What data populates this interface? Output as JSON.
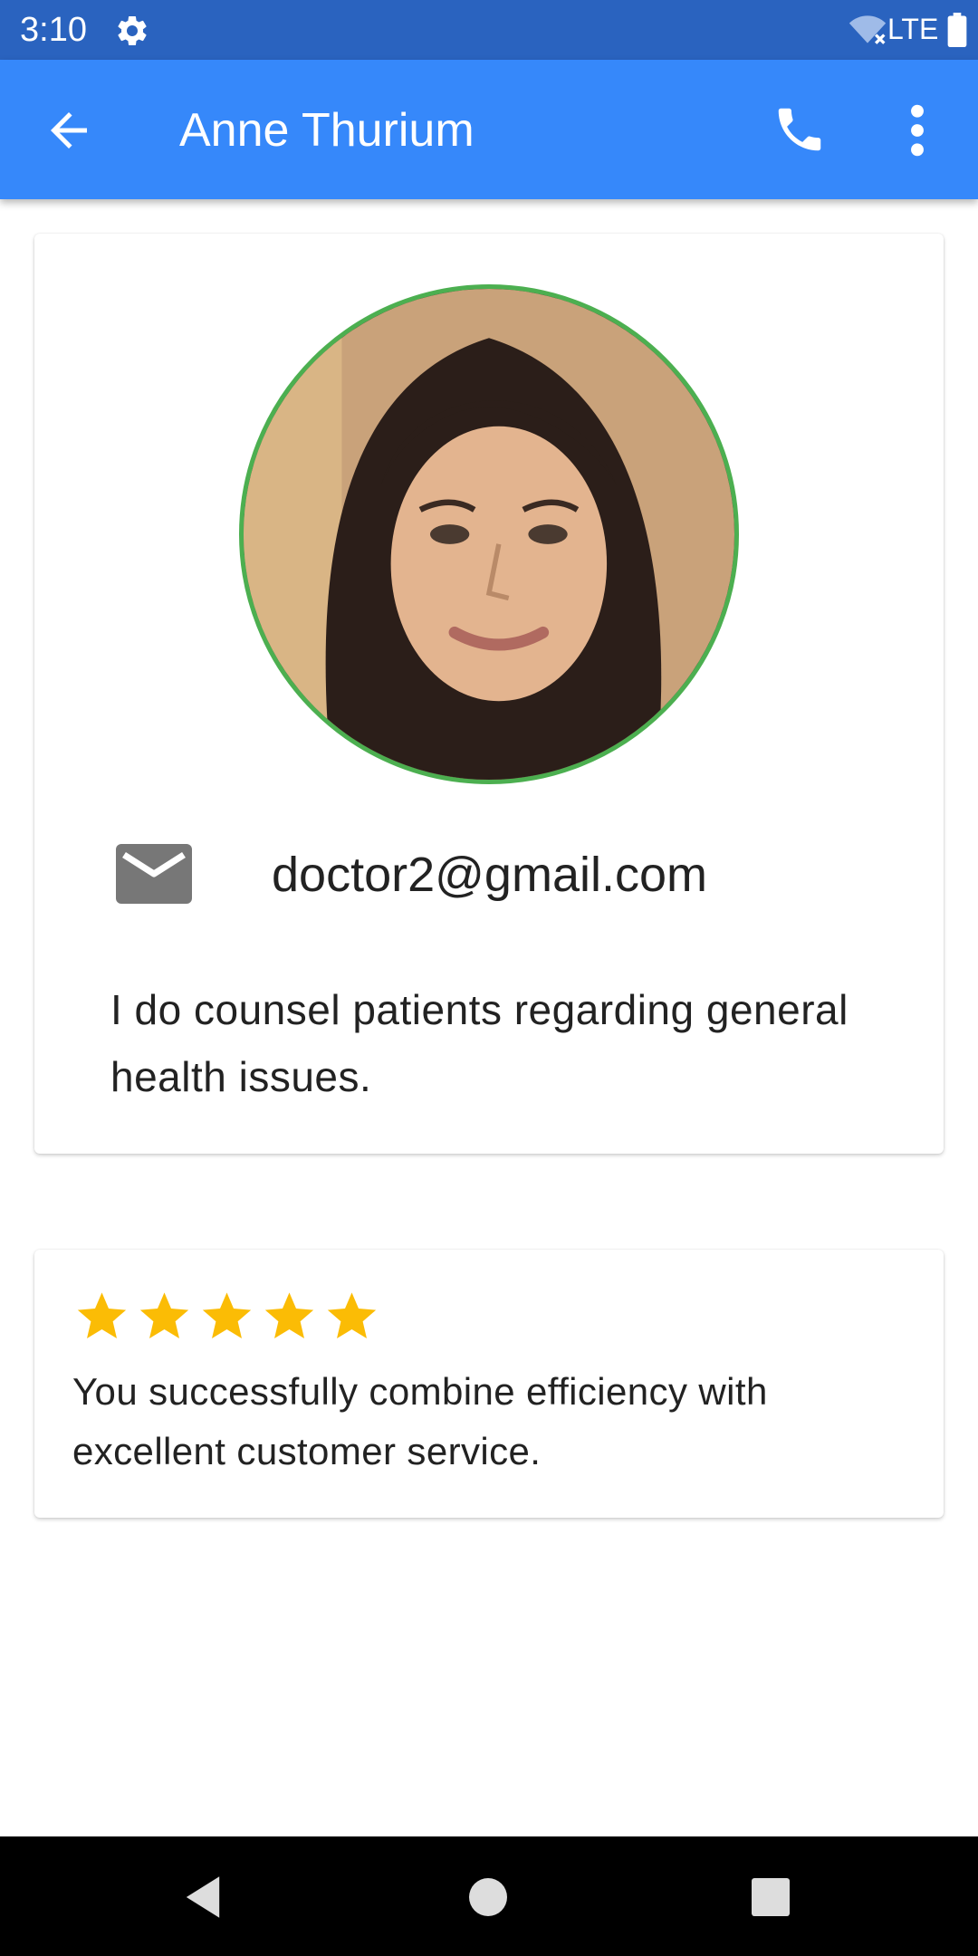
{
  "status_bar": {
    "time": "3:10",
    "network": "LTE",
    "icons": [
      "settings-gear-icon",
      "wifi-off-icon",
      "battery-icon"
    ]
  },
  "app_bar": {
    "title": "Anne Thurium",
    "back_icon": "arrow-back-icon",
    "call_icon": "phone-icon",
    "more_icon": "more-vert-icon",
    "color": "#3688fa"
  },
  "profile": {
    "avatar_border_color": "#4caf50",
    "email": "doctor2@gmail.com",
    "email_icon": "mail-icon",
    "bio": "I do counsel patients regarding general health issues."
  },
  "review": {
    "rating": 5,
    "max_rating": 5,
    "star_color": "#fbbc05",
    "text": "You successfully combine efficiency with excellent customer service."
  },
  "nav_bar": {
    "icons": [
      "nav-back-icon",
      "nav-home-icon",
      "nav-recents-icon"
    ]
  }
}
